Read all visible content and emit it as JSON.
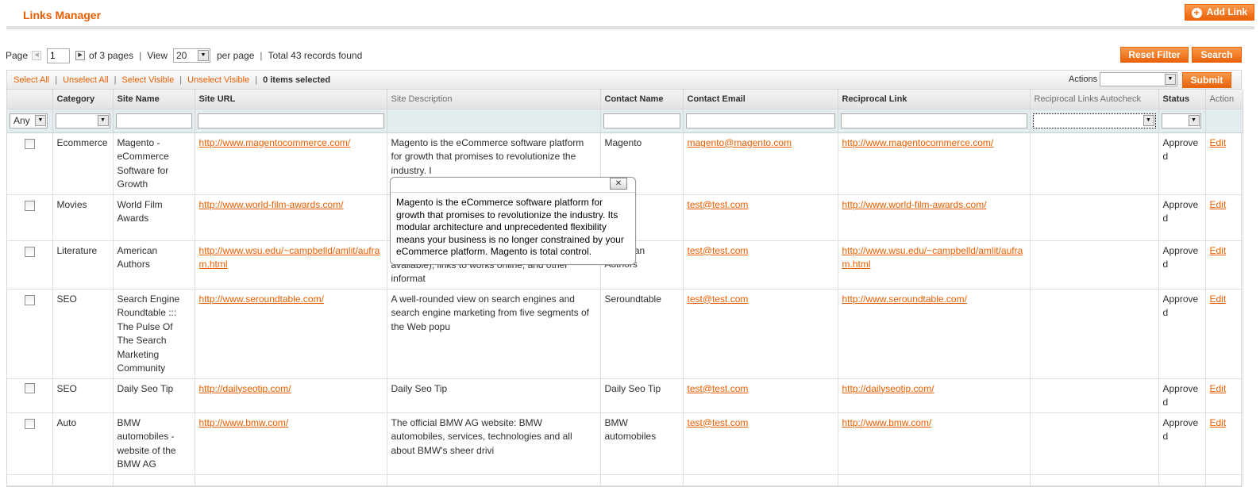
{
  "header": {
    "title": "Links Manager",
    "add_link_label": "Add Link"
  },
  "pager": {
    "page_label": "Page",
    "page_value": "1",
    "of_pages": "of 3 pages",
    "view_label": "View",
    "per_page_value": "20",
    "per_page_label": "per page",
    "total": "Total 43 records found"
  },
  "buttons": {
    "reset_filter": "Reset Filter",
    "search": "Search",
    "submit": "Submit"
  },
  "massaction": {
    "select_all": "Select All",
    "unselect_all": "Unselect All",
    "select_visible": "Select Visible",
    "unselect_visible": "Unselect Visible",
    "items_selected": "0 items selected",
    "actions_label": "Actions"
  },
  "columns": {
    "category": "Category",
    "site_name": "Site Name",
    "site_url": "Site URL",
    "site_description": "Site Description",
    "contact_name": "Contact Name",
    "contact_email": "Contact Email",
    "reciprocal_link": "Reciprocal Link",
    "reciprocal_autocheck": "Reciprocal Links Autocheck",
    "status": "Status",
    "action": "Action"
  },
  "filters": {
    "any": "Any"
  },
  "rows": [
    {
      "category": "Ecommerce",
      "site_name": "Magento - eCommerce Software for Growth",
      "site_url": "http://www.magentocommerce.com/",
      "description": "Magento is the eCommerce software platform for growth that promises to revolutionize the industry. I",
      "contact_name": "Magento",
      "contact_email": "magento@magento.com",
      "reciprocal_link": "http://www.magentocommerce.com/",
      "autocheck": "",
      "status": "Approved",
      "action": "Edit"
    },
    {
      "category": "Movies",
      "site_name": "World Film Awards",
      "site_url": "http://www.world-film-awards.com/",
      "description": "",
      "contact_name": "",
      "contact_email": "test@test.com",
      "reciprocal_link": "http://www.world-film-awards.com/",
      "autocheck": "",
      "status": "Approved",
      "action": "Edit"
    },
    {
      "category": "Literature",
      "site_name": "American Authors",
      "site_url": "http://www.wsu.edu/~campbelld/amlit/aufram.html",
      "description": "available), links to works online, and other informat",
      "contact_name": "American Authors",
      "contact_email": "test@test.com",
      "reciprocal_link": "http://www.wsu.edu/~campbelld/amlit/aufram.html",
      "autocheck": "",
      "status": "Approved",
      "action": "Edit"
    },
    {
      "category": "SEO",
      "site_name": "Search Engine Roundtable ::: The Pulse Of The Search Marketing Community",
      "site_url": "http://www.seroundtable.com/",
      "description": "A well-rounded view on search engines and search engine marketing from five segments of the Web popu",
      "contact_name": "Seroundtable",
      "contact_email": "test@test.com",
      "reciprocal_link": "http://www.seroundtable.com/",
      "autocheck": "",
      "status": "Approved",
      "action": "Edit"
    },
    {
      "category": "SEO",
      "site_name": "Daily Seo Tip",
      "site_url": "http://dailyseotip.com/",
      "description": "Daily Seo Tip",
      "contact_name": "Daily Seo Tip",
      "contact_email": "test@test.com",
      "reciprocal_link": "http://dailyseotip.com/",
      "autocheck": "",
      "status": "Approved",
      "action": "Edit"
    },
    {
      "category": "Auto",
      "site_name": "BMW automobiles - website of the BMW AG",
      "site_url": "http://www.bmw.com/",
      "description": "The official BMW AG website: BMW automobiles, services, technologies and all about BMW's sheer drivi",
      "contact_name": "BMW automobiles",
      "contact_email": "test@test.com",
      "reciprocal_link": "http://www.bmw.com/",
      "autocheck": "",
      "status": "Approved",
      "action": "Edit"
    }
  ],
  "tooltip": {
    "text": "Magento is the eCommerce software platform for growth that promises to revolutionize the industry. Its modular architecture and unprecedented flexibility means your business is no longer constrained by your eCommerce platform. Magento is total control."
  },
  "colors": {
    "accent": "#eb5e00",
    "button": "#f77e26",
    "filter_row": "#e3ecee"
  },
  "icons": {
    "add": "plus-circle-icon",
    "close": "close-icon",
    "dropdown": "chevron-down-icon"
  }
}
